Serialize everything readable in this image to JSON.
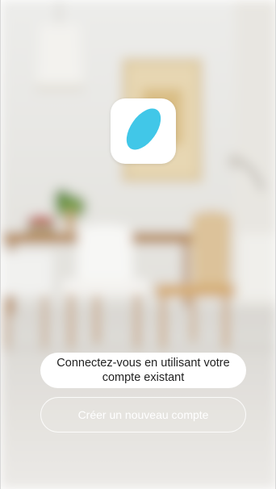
{
  "logo": {
    "icon": "app-logo-icon",
    "accent_color": "#41c7e8"
  },
  "actions": {
    "login_label": "Connectez-vous en utilisant votre compte existant",
    "register_label": "Créer un nouveau compte"
  },
  "colors": {
    "primary_button_bg": "#ffffff",
    "primary_button_text": "#222222",
    "secondary_button_border": "#ffffff"
  }
}
